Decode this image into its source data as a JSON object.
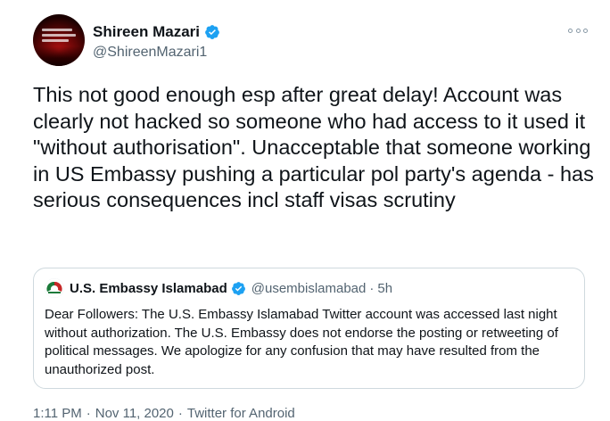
{
  "author": {
    "display_name": "Shireen Mazari",
    "handle": "@ShireenMazari1",
    "verified": true
  },
  "more_icon": "more-horizontal-icon",
  "tweet_text": "This not good enough esp after great delay! Account was clearly not hacked so someone who had access to it used it \"without authorisation\". Unacceptable that someone working in US Embassy pushing a particular pol party's agenda - has serious consequences incl staff visas scrutiny",
  "quoted_tweet": {
    "display_name": "U.S. Embassy Islamabad",
    "handle": "@usembislamabad",
    "separator": "·",
    "time": "5h",
    "verified": true,
    "text": "Dear Followers: The U.S. Embassy Islamabad Twitter account was accessed last night without authorization. The U.S. Embassy does not endorse the posting or retweeting of political messages. We apologize for any confusion that may have resulted from the unauthorized post."
  },
  "meta": {
    "time": "1:11 PM",
    "date": "Nov 11, 2020",
    "source": "Twitter for Android",
    "separator": "·"
  },
  "colors": {
    "text": "#0f1419",
    "secondary": "#536471",
    "verified_blue": "#1da1f2",
    "border": "#cfd9de"
  }
}
